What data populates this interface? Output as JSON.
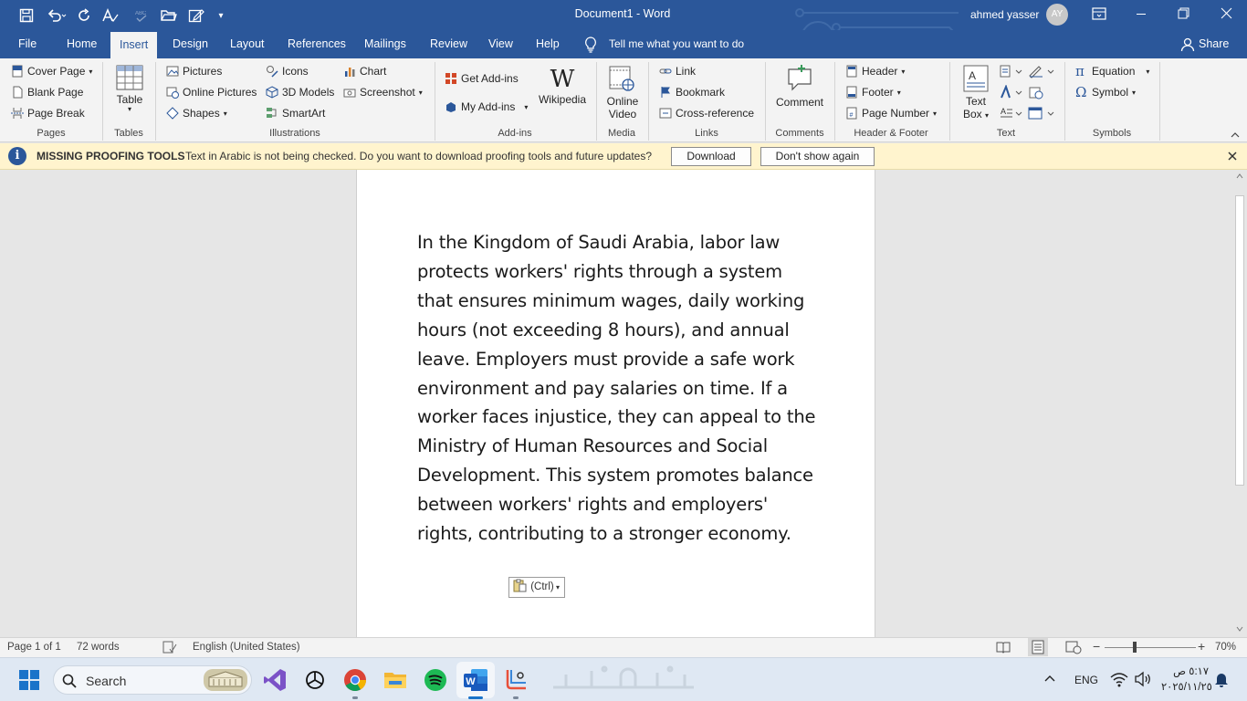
{
  "title": "Document1 - Word",
  "user": {
    "name": "ahmed yasser",
    "initials": "AY"
  },
  "share": "Share",
  "tabs": [
    "File",
    "Home",
    "Insert",
    "Design",
    "Layout",
    "References",
    "Mailings",
    "Review",
    "View",
    "Help"
  ],
  "tell_me": "Tell me what you want to do",
  "ribbon": {
    "pages": {
      "cover": "Cover Page",
      "blank": "Blank Page",
      "break": "Page Break",
      "label": "Pages"
    },
    "tables": {
      "table": "Table",
      "label": "Tables"
    },
    "illustrations": {
      "pictures": "Pictures",
      "online_pictures": "Online Pictures",
      "shapes": "Shapes",
      "icons": "Icons",
      "models": "3D Models",
      "smartart": "SmartArt",
      "chart": "Chart",
      "screenshot": "Screenshot",
      "label": "Illustrations"
    },
    "addins": {
      "get": "Get Add-ins",
      "my": "My Add-ins",
      "wikipedia": "Wikipedia",
      "label": "Add-ins"
    },
    "media": {
      "video1": "Online",
      "video2": "Video",
      "label": "Media"
    },
    "links": {
      "link": "Link",
      "bookmark": "Bookmark",
      "cross": "Cross-reference",
      "label": "Links"
    },
    "comments": {
      "comment": "Comment",
      "label": "Comments"
    },
    "header_footer": {
      "header": "Header",
      "footer": "Footer",
      "page_number": "Page Number",
      "label": "Header & Footer"
    },
    "text": {
      "textbox1": "Text",
      "textbox2": "Box",
      "label": "Text"
    },
    "symbols": {
      "equation": "Equation",
      "symbol": "Symbol",
      "label": "Symbols"
    }
  },
  "message_bar": {
    "title": "MISSING PROOFING TOOLS",
    "text": "Text in Arabic is not being checked. Do you want to download proofing tools and future updates?",
    "download": "Download",
    "dont_show": "Don't show again"
  },
  "document": {
    "body": "In the Kingdom of Saudi Arabia, labor law protects workers' rights through a system that ensures minimum wages, daily working hours (not exceeding 8 hours), and annual leave. Employers must provide a safe work environment and pay salaries on time. If a worker faces injustice, they can appeal to the Ministry of Human Resources and Social Development. This system promotes balance between workers' rights and employers' rights, contributing to a stronger economy.",
    "paste_options": "(Ctrl)"
  },
  "status": {
    "page": "Page 1 of 1",
    "words": "72 words",
    "language": "English (United States)",
    "zoom": "70%",
    "zoom_level_percent": 70
  },
  "taskbar": {
    "search": "Search",
    "lang": "ENG",
    "time": "٥:١٧ ص",
    "date": "٢٠٢٥/١١/٢٥"
  },
  "colors": {
    "word_blue": "#2b579a",
    "message_bar": "#fff4ce"
  }
}
